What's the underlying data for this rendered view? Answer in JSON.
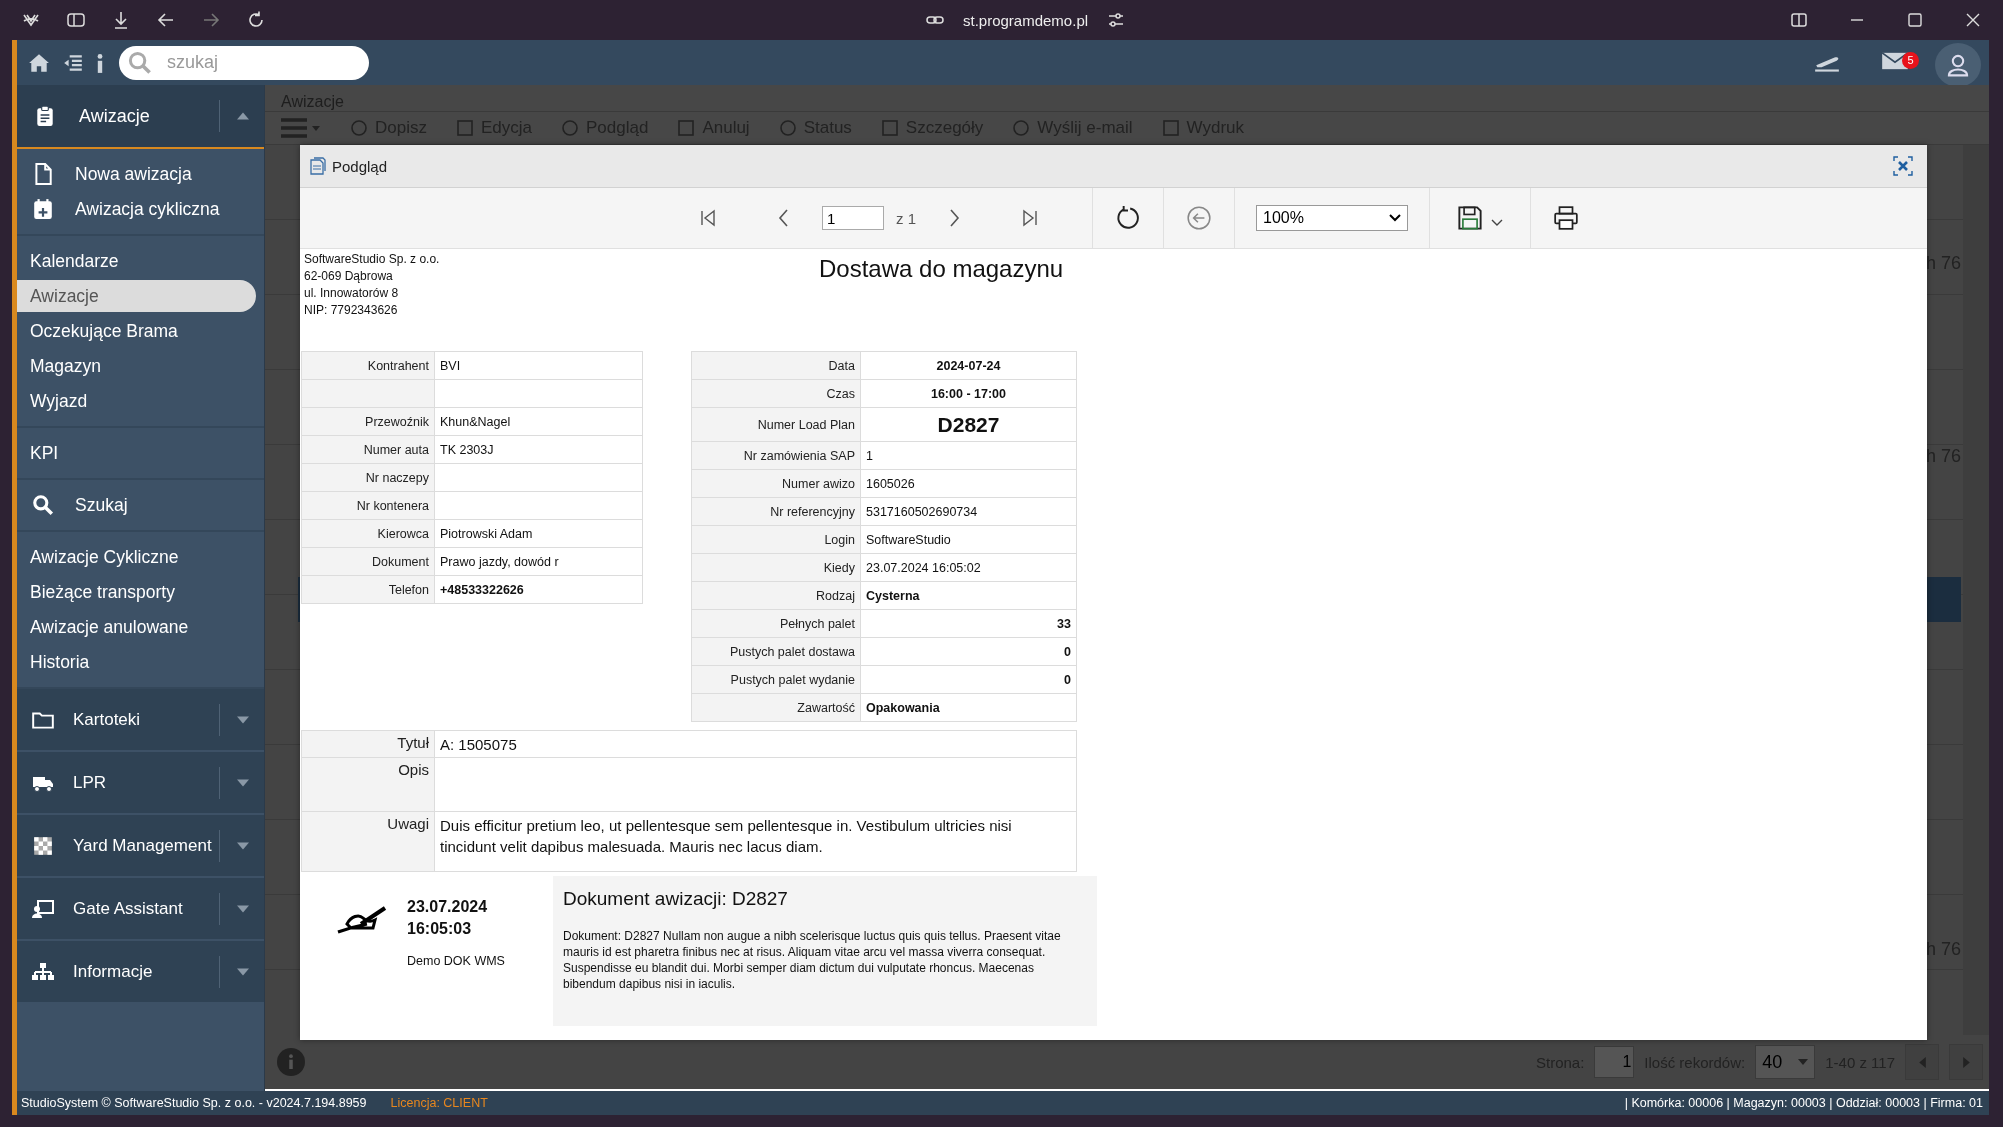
{
  "browser": {
    "url": "st.programdemo.pl"
  },
  "header": {
    "search": {
      "placeholder": "szukaj"
    },
    "mail_badge": "5"
  },
  "sidebar": {
    "top": {
      "label": "Awizacje",
      "expanded": true
    },
    "groups": [
      {
        "items": [
          {
            "label": "Nowa awizacja",
            "selected": false
          },
          {
            "label": "Awizacja cykliczna",
            "selected": false
          }
        ]
      },
      {
        "items": [
          {
            "label": "Kalendarze",
            "selected": false
          },
          {
            "label": "Awizacje",
            "selected": true
          },
          {
            "label": "Oczekujące Brama",
            "selected": false
          },
          {
            "label": "Magazyn",
            "selected": false
          },
          {
            "label": "Wyjazd",
            "selected": false
          }
        ]
      },
      {
        "items": [
          {
            "label": "KPI",
            "selected": false
          }
        ]
      },
      {
        "items": [
          {
            "label": "Szukaj",
            "selected": false
          }
        ]
      },
      {
        "items": [
          {
            "label": "Awizacje Cykliczne",
            "selected": false
          },
          {
            "label": "Bieżące transporty",
            "selected": false
          },
          {
            "label": "Awizacje anulowane",
            "selected": false
          },
          {
            "label": "Historia",
            "selected": false
          }
        ]
      }
    ],
    "sections": [
      {
        "label": "Kartoteki",
        "expanded": false
      },
      {
        "label": "LPR",
        "expanded": false
      },
      {
        "label": "Yard Management",
        "expanded": false
      },
      {
        "label": "Gate Assistant",
        "expanded": false
      },
      {
        "label": "Informacje",
        "expanded": false
      }
    ]
  },
  "background": {
    "breadcrumb": "Awizacje",
    "toolbar": [
      "Dopisz",
      "Edycja",
      "Podgląd",
      "Anuluj",
      "Status",
      "Szczegóły",
      "Wyślij e-mail",
      "Wydruk"
    ],
    "cells": [
      "h 76",
      "h 76",
      "h 76"
    ],
    "pager": {
      "page_label": "Strona:",
      "page": "1",
      "count_label": "Ilość rekordów:",
      "count": "40",
      "range": "1-40 z 117"
    }
  },
  "modal": {
    "title": "Podgląd",
    "toolbar": {
      "page": "1",
      "of": "z 1",
      "zoom": "100%"
    },
    "document": {
      "company": [
        "SoftwareStudio Sp. z o.o.",
        "62-069 Dąbrowa",
        "ul. Innowatorów 8",
        "NIP: 7792343626"
      ],
      "title": "Dostawa do magazynu",
      "left_table": [
        {
          "label": "Kontrahent",
          "value": "BVI",
          "kind": "plain"
        },
        {
          "kind": "blank"
        },
        {
          "label": "Przewoźnik",
          "value": "Khun&Nagel",
          "kind": "plain"
        },
        {
          "label": "Numer auta",
          "value": "TK 2303J",
          "kind": "plain"
        },
        {
          "label": "Nr naczepy",
          "kind": "plain"
        },
        {
          "label": "Nr kontenera",
          "kind": "plain"
        },
        {
          "label": "Kierowca",
          "value": "Piotrowski Adam",
          "kind": "plain"
        },
        {
          "label": "Dokument",
          "value": "Prawo jazdy, dowód r",
          "kind": "plain"
        },
        {
          "label": "Telefon",
          "value": "+48533322626",
          "kind": "bold"
        }
      ],
      "right_table": [
        {
          "label": "Data",
          "value": "2024-07-24",
          "kind": "center"
        },
        {
          "label": "Czas",
          "value": "16:00 - 17:00",
          "kind": "center"
        },
        {
          "label": "Numer Load Plan",
          "value": "D2827",
          "kind": "big"
        },
        {
          "label": "Nr zamówienia SAP",
          "value": "1",
          "kind": "plain"
        },
        {
          "label": "Numer awizo",
          "value": "1605026",
          "kind": "plain"
        },
        {
          "label": "Nr referencyjny",
          "value": "5317160502690734",
          "kind": "plain"
        },
        {
          "label": "Login",
          "value": "SoftwareStudio",
          "kind": "plain"
        },
        {
          "label": "Kiedy",
          "value": "23.07.2024 16:05:02",
          "kind": "plain"
        },
        {
          "label": "Rodzaj",
          "value": "Cysterna",
          "kind": "bold"
        },
        {
          "label": "Pełnych palet",
          "value": "33",
          "kind": "number"
        },
        {
          "label": "Pustych palet dostawa",
          "value": "0",
          "kind": "number"
        },
        {
          "label": "Pustych palet wydanie",
          "value": "0",
          "kind": "number"
        },
        {
          "label": "Zawartość",
          "value": "Opakowania",
          "kind": "bold"
        }
      ],
      "notes": [
        {
          "label": "Tytuł",
          "value": "A: 1505075"
        },
        {
          "label": "Opis"
        },
        {
          "label": "Uwagi",
          "value": "Duis efficitur pretium leo, ut pellentesque sem pellentesque in. Vestibulum ultricies nisi tincidunt velit dapibus malesuada. Mauris nec lacus diam."
        }
      ],
      "signature": {
        "date": "23.07.2024",
        "time": "16:05:03",
        "author": "Demo DOK WMS"
      },
      "doc_box": {
        "heading": "Dokument awizacji: D2827",
        "text": "Dokument: D2827 Nullam non augue a nibh scelerisque luctus quis quis tellus. Praesent vitae mauris id est pharetra finibus nec at risus. Aliquam vitae arcu vel massa viverra consequat. Suspendisse eu blandit dui. Morbi semper diam dictum dui vulputate rhoncus. Maecenas bibendum dapibus nisi in iaculis."
      }
    }
  },
  "status_bar": {
    "left": "StudioSystem © SoftwareStudio Sp. z o.o. - v2024.7.194.8959",
    "license": "Licencja: CLIENT",
    "right": "| Komórka: 00006 | Magazyn: 00003 | Oddział: 00003 | Firma: 01"
  }
}
